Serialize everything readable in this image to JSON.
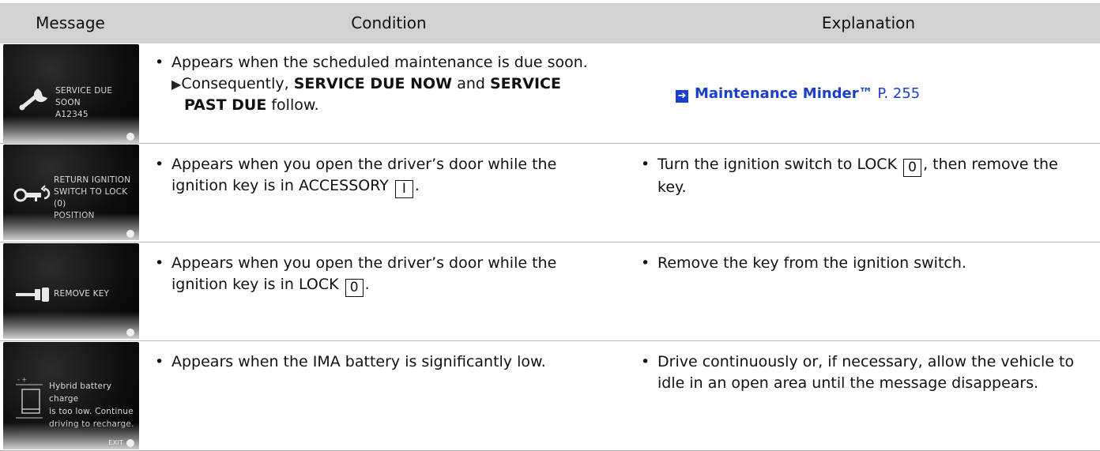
{
  "headers": {
    "message": "Message",
    "condition": "Condition",
    "explanation": "Explanation"
  },
  "rows": [
    {
      "screen": {
        "lines": [
          "SERVICE DUE SOON",
          "A12345"
        ],
        "icon": "wrench-icon"
      },
      "condition": {
        "bullet": "Appears when the scheduled maintenance is due soon.",
        "sub_prefix": "Consequently, ",
        "sub_bold1": "SERVICE DUE NOW",
        "sub_mid": " and ",
        "sub_bold2": "SERVICE",
        "sub_bold3": "PAST DUE",
        "sub_suffix": " follow."
      },
      "explanation": {
        "link_title": "Maintenance Minder™",
        "link_page": " P. 255"
      }
    },
    {
      "screen": {
        "lines": [
          "RETURN IGNITION",
          "SWITCH TO LOCK (0)",
          "POSITION"
        ],
        "icon": "key-icon"
      },
      "condition": {
        "line1": "Appears when you open the driver’s door while the",
        "line2_prefix": "ignition key is in ACCESSORY ",
        "key": "I",
        "line2_suffix": "."
      },
      "explanation": {
        "line1_prefix": "Turn the ignition switch to LOCK ",
        "key": "0",
        "line1_suffix": ", then remove the",
        "line2": "key."
      }
    },
    {
      "screen": {
        "lines": [
          "REMOVE KEY"
        ],
        "icon": "key-icon"
      },
      "condition": {
        "line1": "Appears when you open the driver’s door while the",
        "line2_prefix": "ignition key is in LOCK ",
        "key": "0",
        "line2_suffix": "."
      },
      "explanation": {
        "line1": "Remove the key from the ignition switch."
      }
    },
    {
      "screen": {
        "lines": [
          "Hybrid battery charge",
          "is too low. Continue",
          "driving to recharge."
        ],
        "footer": "EXIT",
        "icon": "battery-icon"
      },
      "condition": {
        "line1": "Appears when the IMA battery is significantly low."
      },
      "explanation": {
        "line1": "Drive continuously or, if necessary, allow the vehicle to",
        "line2": "idle in an open area until the message disappears."
      }
    }
  ]
}
